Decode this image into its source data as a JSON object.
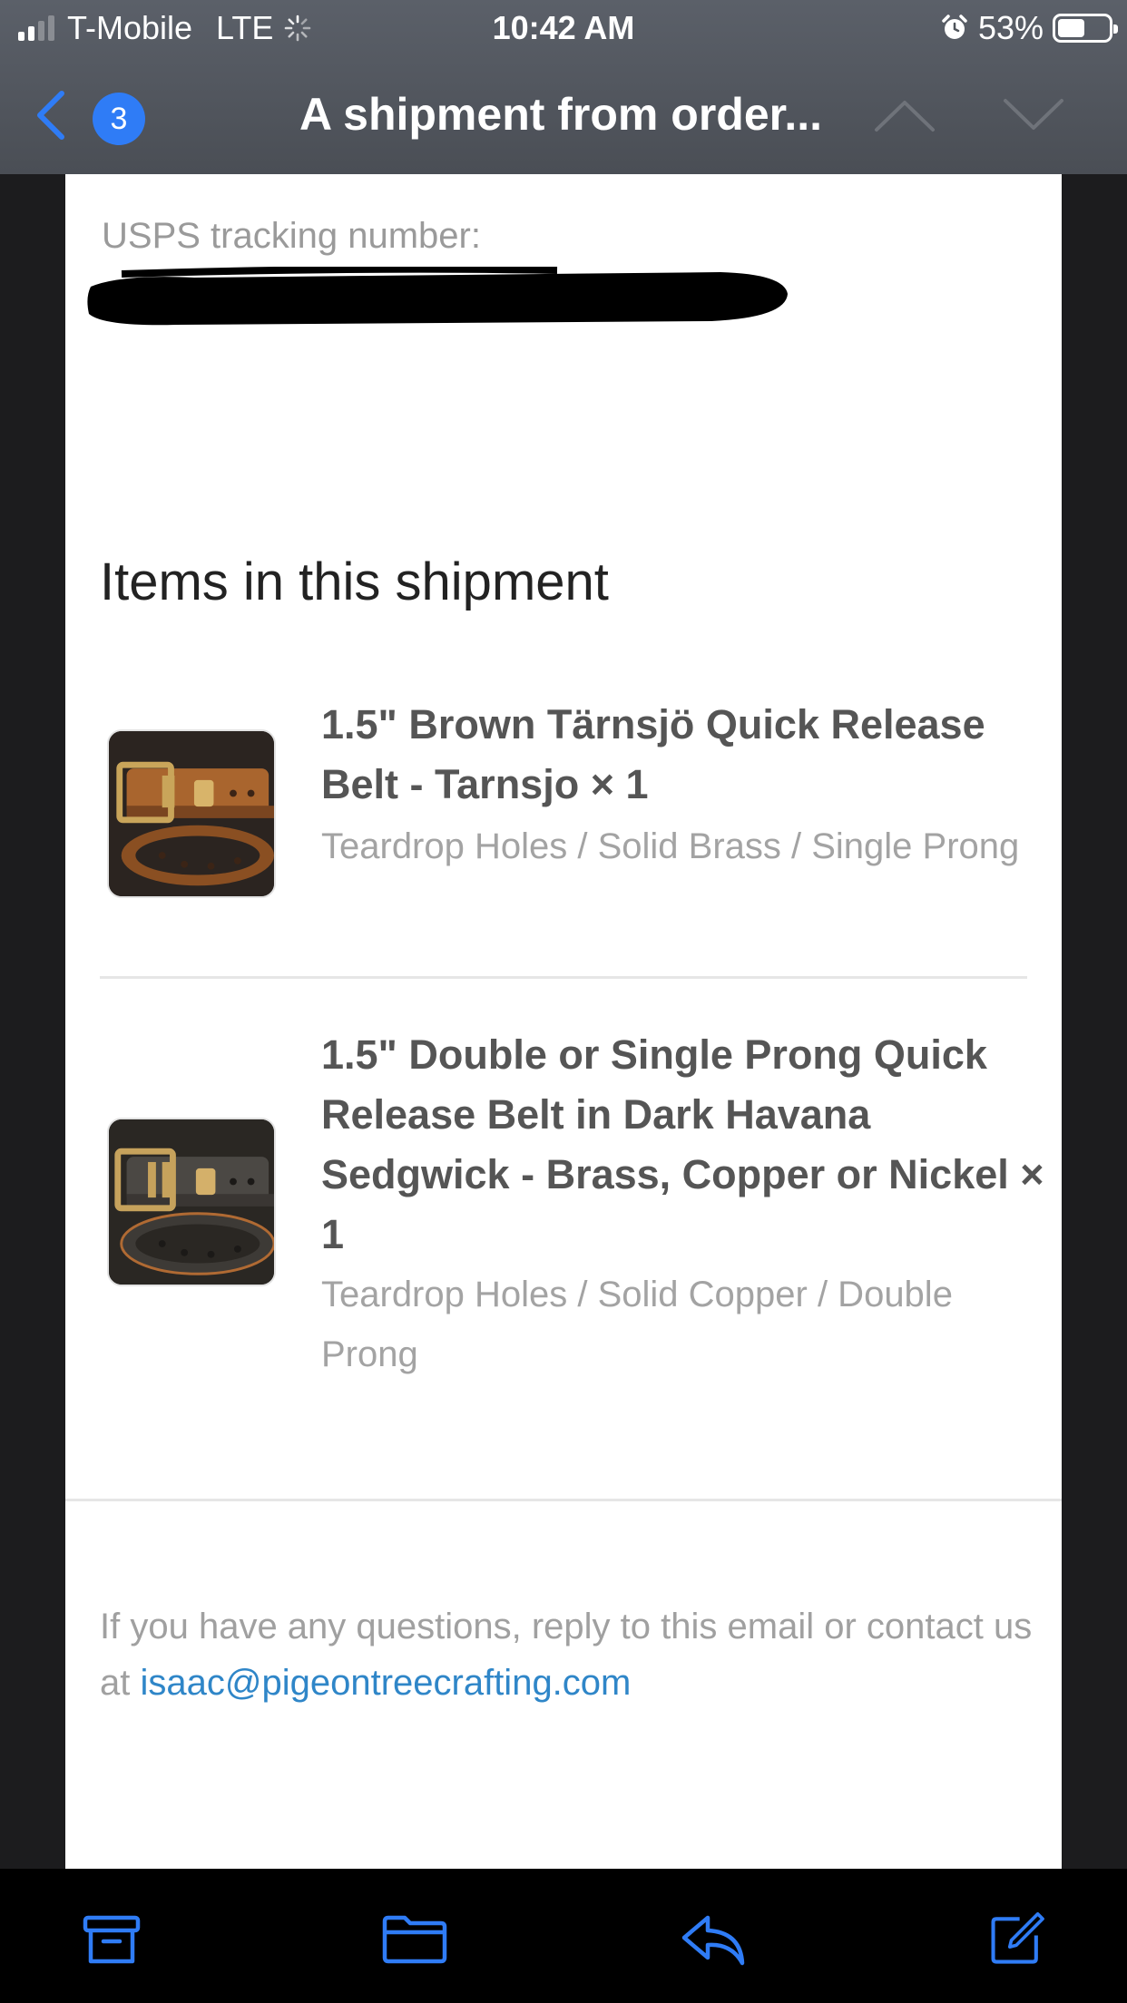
{
  "status_bar": {
    "carrier": "T-Mobile",
    "network": "LTE",
    "time": "10:42 AM",
    "battery_percent": "53%",
    "battery_level": 0.53
  },
  "nav": {
    "back_count": "3",
    "title": "A shipment from order..."
  },
  "email": {
    "tracking_label": "USPS tracking number:",
    "items_heading": "Items in this shipment",
    "items": [
      {
        "title": "1.5\" Brown Tärnsjö Quick Release Belt - Tarnsjo × 1",
        "variant": "Teardrop Holes / Solid Brass / Single Prong",
        "thumb_icon": "brown-belt-photo"
      },
      {
        "title": "1.5\" Double or Single Prong Quick Release Belt in Dark Havana Sedgwick - Brass, Copper or Nickel × 1",
        "variant": "Teardrop Holes / Solid Copper / Double Prong",
        "thumb_icon": "dark-belt-photo"
      }
    ],
    "footer_text": "If you have any questions, reply to this email or contact us at ",
    "footer_link": "isaac@pigeontreecrafting.com"
  },
  "toolbar": {
    "icons": [
      "archive-icon",
      "folder-icon",
      "reply-icon",
      "compose-icon"
    ]
  },
  "colors": {
    "accent": "#2f7cf6",
    "link": "#2f86c8",
    "nav_background": "#4a4e55"
  }
}
